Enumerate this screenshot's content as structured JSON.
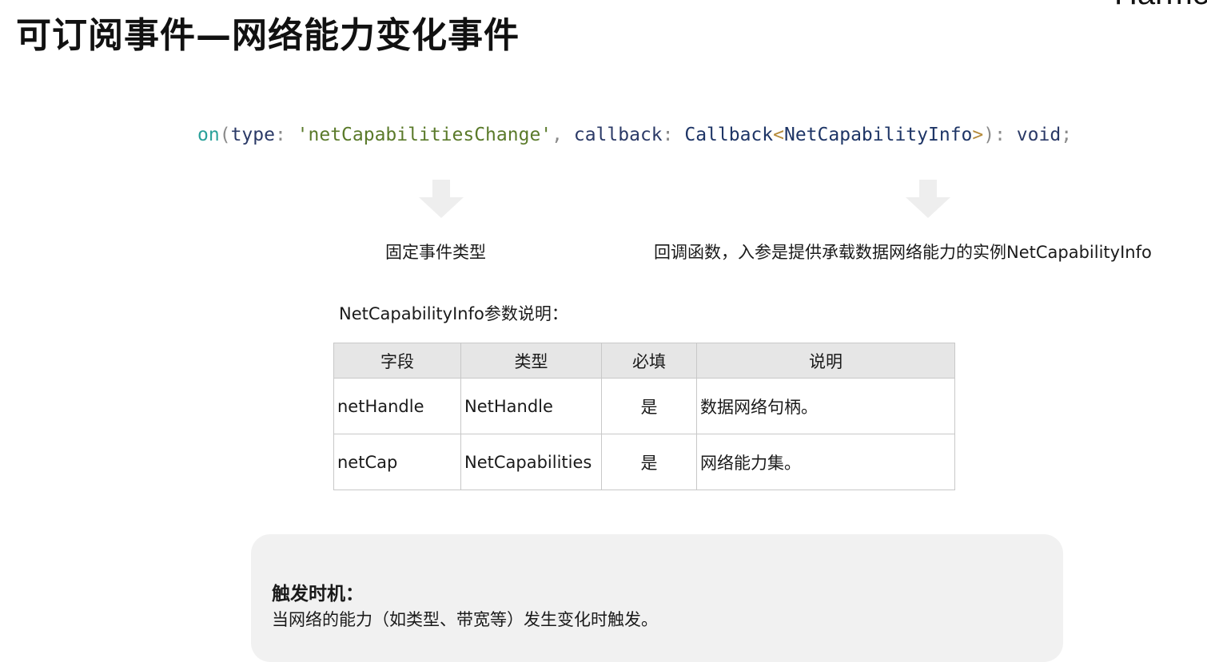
{
  "brand": "Harmo",
  "title": "可订阅事件—网络能力变化事件",
  "code": {
    "fn": "on",
    "open_paren": "(",
    "param1_name": "type",
    "colon1": ": ",
    "param1_value": "'netCapabilitiesChange'",
    "comma": ", ",
    "param2_name": "callback",
    "colon2": ": ",
    "param2_type": "Callback",
    "angle_open": "<",
    "generic_type": "NetCapabilityInfo",
    "angle_close": ">",
    "close_paren": "): ",
    "return_type": "void",
    "semicolon": ";"
  },
  "arrows": {
    "left_icon": "down-arrow-icon",
    "right_icon": "down-arrow-icon",
    "color": "#eeeeee"
  },
  "captions": {
    "left": "固定事件类型",
    "right": "回调函数，入参是提供承载数据网络能力的实例NetCapabilityInfo"
  },
  "table": {
    "caption": "NetCapabilityInfo参数说明：",
    "headers": [
      "字段",
      "类型",
      "必填",
      "说明"
    ],
    "rows": [
      [
        "netHandle",
        "NetHandle",
        "是",
        "数据网络句柄。"
      ],
      [
        "netCap",
        "NetCapabilities",
        "是",
        "网络能力集。"
      ]
    ]
  },
  "note": {
    "heading": "触发时机：",
    "body": "当网络的能力（如类型、带宽等）发生变化时触发。"
  }
}
